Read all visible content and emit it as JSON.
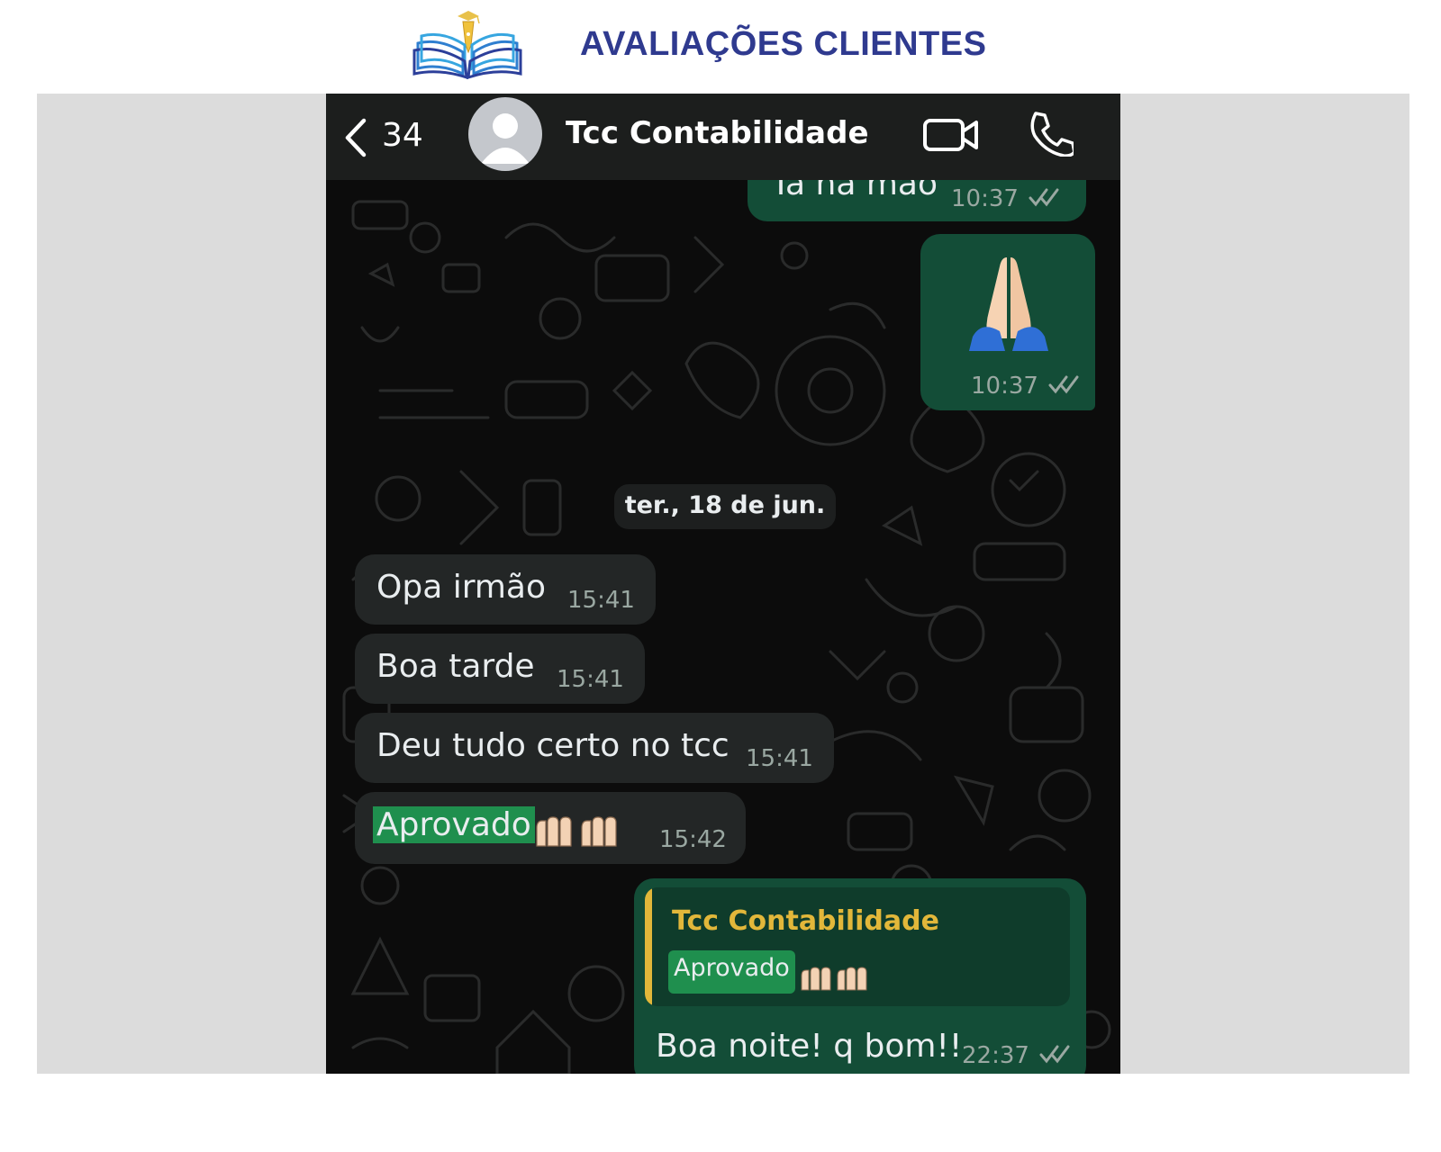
{
  "page": {
    "title": "AVALIAÇÕES CLIENTES"
  },
  "chat": {
    "header": {
      "back_count": "34",
      "contact_name": "Tcc Contabilidade"
    },
    "messages": [
      {
        "direction": "outgoing",
        "text": "Tá na mão",
        "time": "10:37",
        "read": true
      },
      {
        "direction": "outgoing",
        "emoji": "folded-hands",
        "time": "10:37",
        "read": true
      },
      {
        "direction": "incoming",
        "text": "Opa irmão",
        "time": "15:41"
      },
      {
        "direction": "incoming",
        "text": "Boa tarde",
        "time": "15:41"
      },
      {
        "direction": "incoming",
        "text": "Deu tudo certo no tcc",
        "time": "15:41"
      },
      {
        "direction": "incoming",
        "text": "Aprovado",
        "emoji": "raised-hands x2",
        "time": "15:42"
      },
      {
        "direction": "outgoing",
        "reply_to": {
          "author": "Tcc Contabilidade",
          "text": "Aprovado",
          "emoji": "raised-hands x2"
        },
        "text": "Boa noite! q bom!!",
        "time": "22:37",
        "read": true
      }
    ],
    "date_divider": "ter., 18 de jun."
  },
  "colors": {
    "title": "#2f3a8f",
    "outgoing_bubble": "#134d37",
    "incoming_bubble": "#232626",
    "highlight": "#1f8f4e",
    "reply_author": "#e2b73a",
    "frame": "#dcdcdc"
  }
}
